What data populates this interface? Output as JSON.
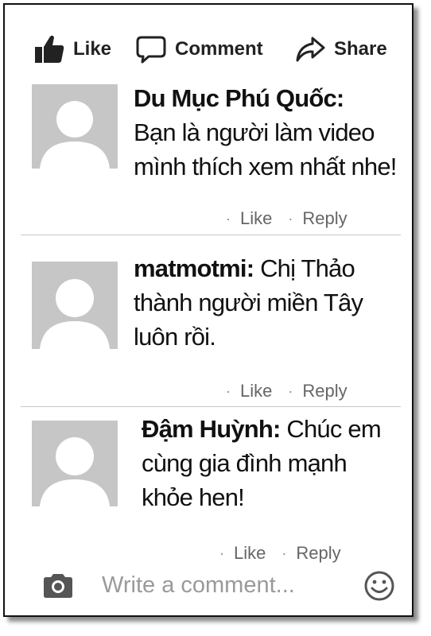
{
  "actions": {
    "like": "Like",
    "comment": "Comment",
    "share": "Share"
  },
  "comments": [
    {
      "author": "Du Mục Phú Quốc:",
      "line1": "Bạn là người làm video",
      "line2": "mình thích xem nhất nhe!",
      "line3": "",
      "like": "Like",
      "reply": "Reply"
    },
    {
      "author": "matmotmi:",
      "line1": " Chị Thảo",
      "line2": "thành người miền Tây",
      "line3": "luôn rồi.",
      "like": "Like",
      "reply": "Reply"
    },
    {
      "author": "Đậm Huỳnh:",
      "line1": " Chúc em",
      "line2": "cùng gia đình mạnh",
      "line3": "khỏe hen!",
      "like": "Like",
      "reply": "Reply"
    }
  ],
  "composer": {
    "placeholder": "Write a comment..."
  },
  "icons": {
    "like": "thumbs-up-icon",
    "comment": "speech-bubble-icon",
    "share": "share-arrow-icon",
    "camera": "camera-icon",
    "emoji": "smiley-icon",
    "avatar": "default-avatar-icon"
  },
  "colors": {
    "text": "#111111",
    "meta": "#666666",
    "placeholder": "#9a9a9a",
    "avatar_bg": "#c6c6c6",
    "icon": "#555555"
  }
}
